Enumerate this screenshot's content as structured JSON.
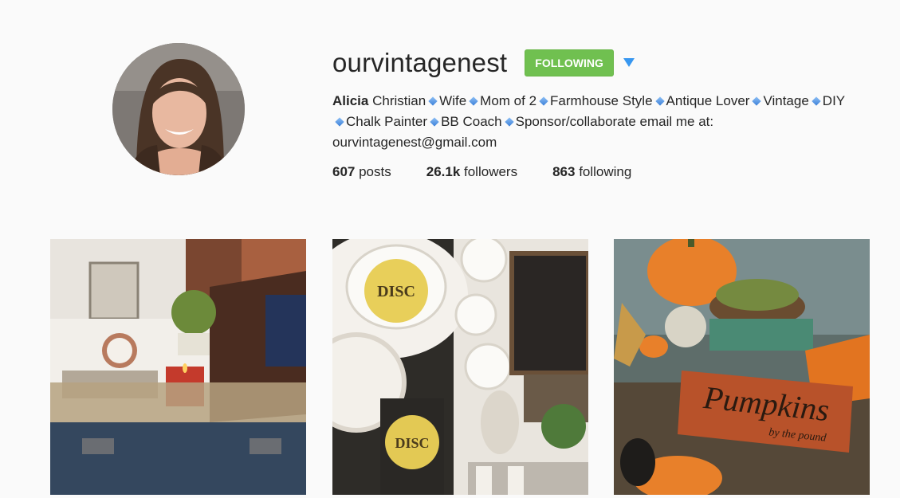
{
  "profile": {
    "username": "ourvintagenest",
    "follow_label": "FOLLOWING",
    "dropdown_icon": "caret-down-icon",
    "bio": {
      "name_bold": "Alicia",
      "name_rest": " Christian",
      "items": [
        "Wife",
        "Mom of 2",
        "Farmhouse Style",
        "Antique Lover",
        "Vintage",
        "DIY",
        "Chalk Painter",
        "BB Coach",
        "Sponsor/collaborate email me at: ourvintagenest@gmail.com"
      ]
    },
    "stats": {
      "posts_count": "607",
      "posts_label": " posts",
      "followers_count": "26.1k",
      "followers_label": " followers",
      "following_count": "863",
      "following_label": " following"
    }
  },
  "posts": [
    {
      "label": "",
      "sign": "",
      "sign_sub": ""
    },
    {
      "label": "DISC",
      "sign": "",
      "sign_sub": ""
    },
    {
      "label": "",
      "sign": "Pumpkins",
      "sign_sub": "by the pound"
    }
  ],
  "colors": {
    "follow_green": "#70c050",
    "diamond_blue": "#4a8ce0",
    "background": "#fafafa"
  }
}
